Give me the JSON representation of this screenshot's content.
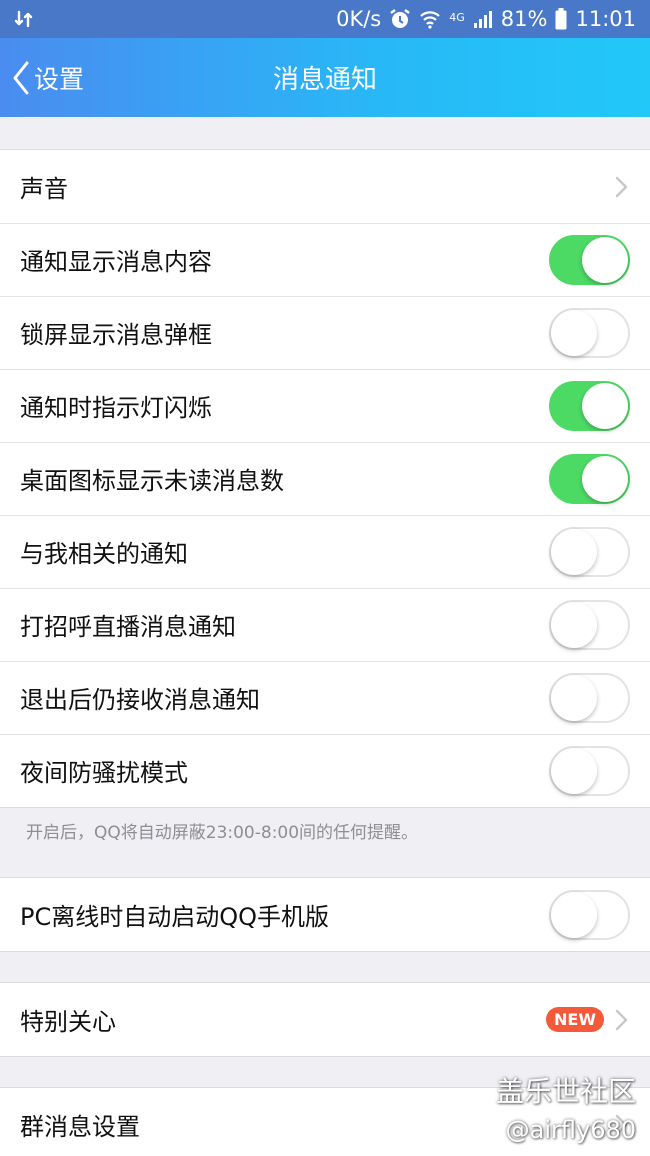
{
  "status_bar": {
    "left_icon": "data-transfer-icon",
    "speed": "0K/s",
    "icons": [
      "alarm-icon",
      "wifi-icon",
      "cellular-4g-icon",
      "signal-icon"
    ],
    "network": "4G",
    "battery_text": "81%",
    "time": "11:01"
  },
  "nav": {
    "back_label": "设置",
    "title": "消息通知"
  },
  "group1": {
    "items": [
      {
        "label": "声音",
        "type": "link"
      },
      {
        "label": "通知显示消息内容",
        "type": "toggle",
        "on": true
      },
      {
        "label": "锁屏显示消息弹框",
        "type": "toggle",
        "on": false
      },
      {
        "label": "通知时指示灯闪烁",
        "type": "toggle",
        "on": true
      },
      {
        "label": "桌面图标显示未读消息数",
        "type": "toggle",
        "on": true
      },
      {
        "label": "与我相关的通知",
        "type": "toggle",
        "on": false
      },
      {
        "label": "打招呼直播消息通知",
        "type": "toggle",
        "on": false
      },
      {
        "label": "退出后仍接收消息通知",
        "type": "toggle",
        "on": false
      },
      {
        "label": "夜间防骚扰模式",
        "type": "toggle",
        "on": false
      }
    ],
    "note": "开启后，QQ将自动屏蔽23:00-8:00间的任何提醒。"
  },
  "group2": {
    "items": [
      {
        "label": "PC离线时自动启动QQ手机版",
        "type": "toggle",
        "on": false
      }
    ]
  },
  "group3": {
    "items": [
      {
        "label": "特别关心",
        "type": "link",
        "badge": "NEW"
      }
    ]
  },
  "group4": {
    "items": [
      {
        "label": "群消息设置",
        "type": "link"
      }
    ]
  },
  "watermark": {
    "line1": "盖乐世社区",
    "line2": "@airfly680"
  },
  "colors": {
    "nav_gradient_start": "#4a8cf0",
    "nav_gradient_end": "#22c8f8",
    "toggle_on": "#4cd964",
    "badge": "#f25a3a",
    "page_bg": "#efeff4"
  }
}
